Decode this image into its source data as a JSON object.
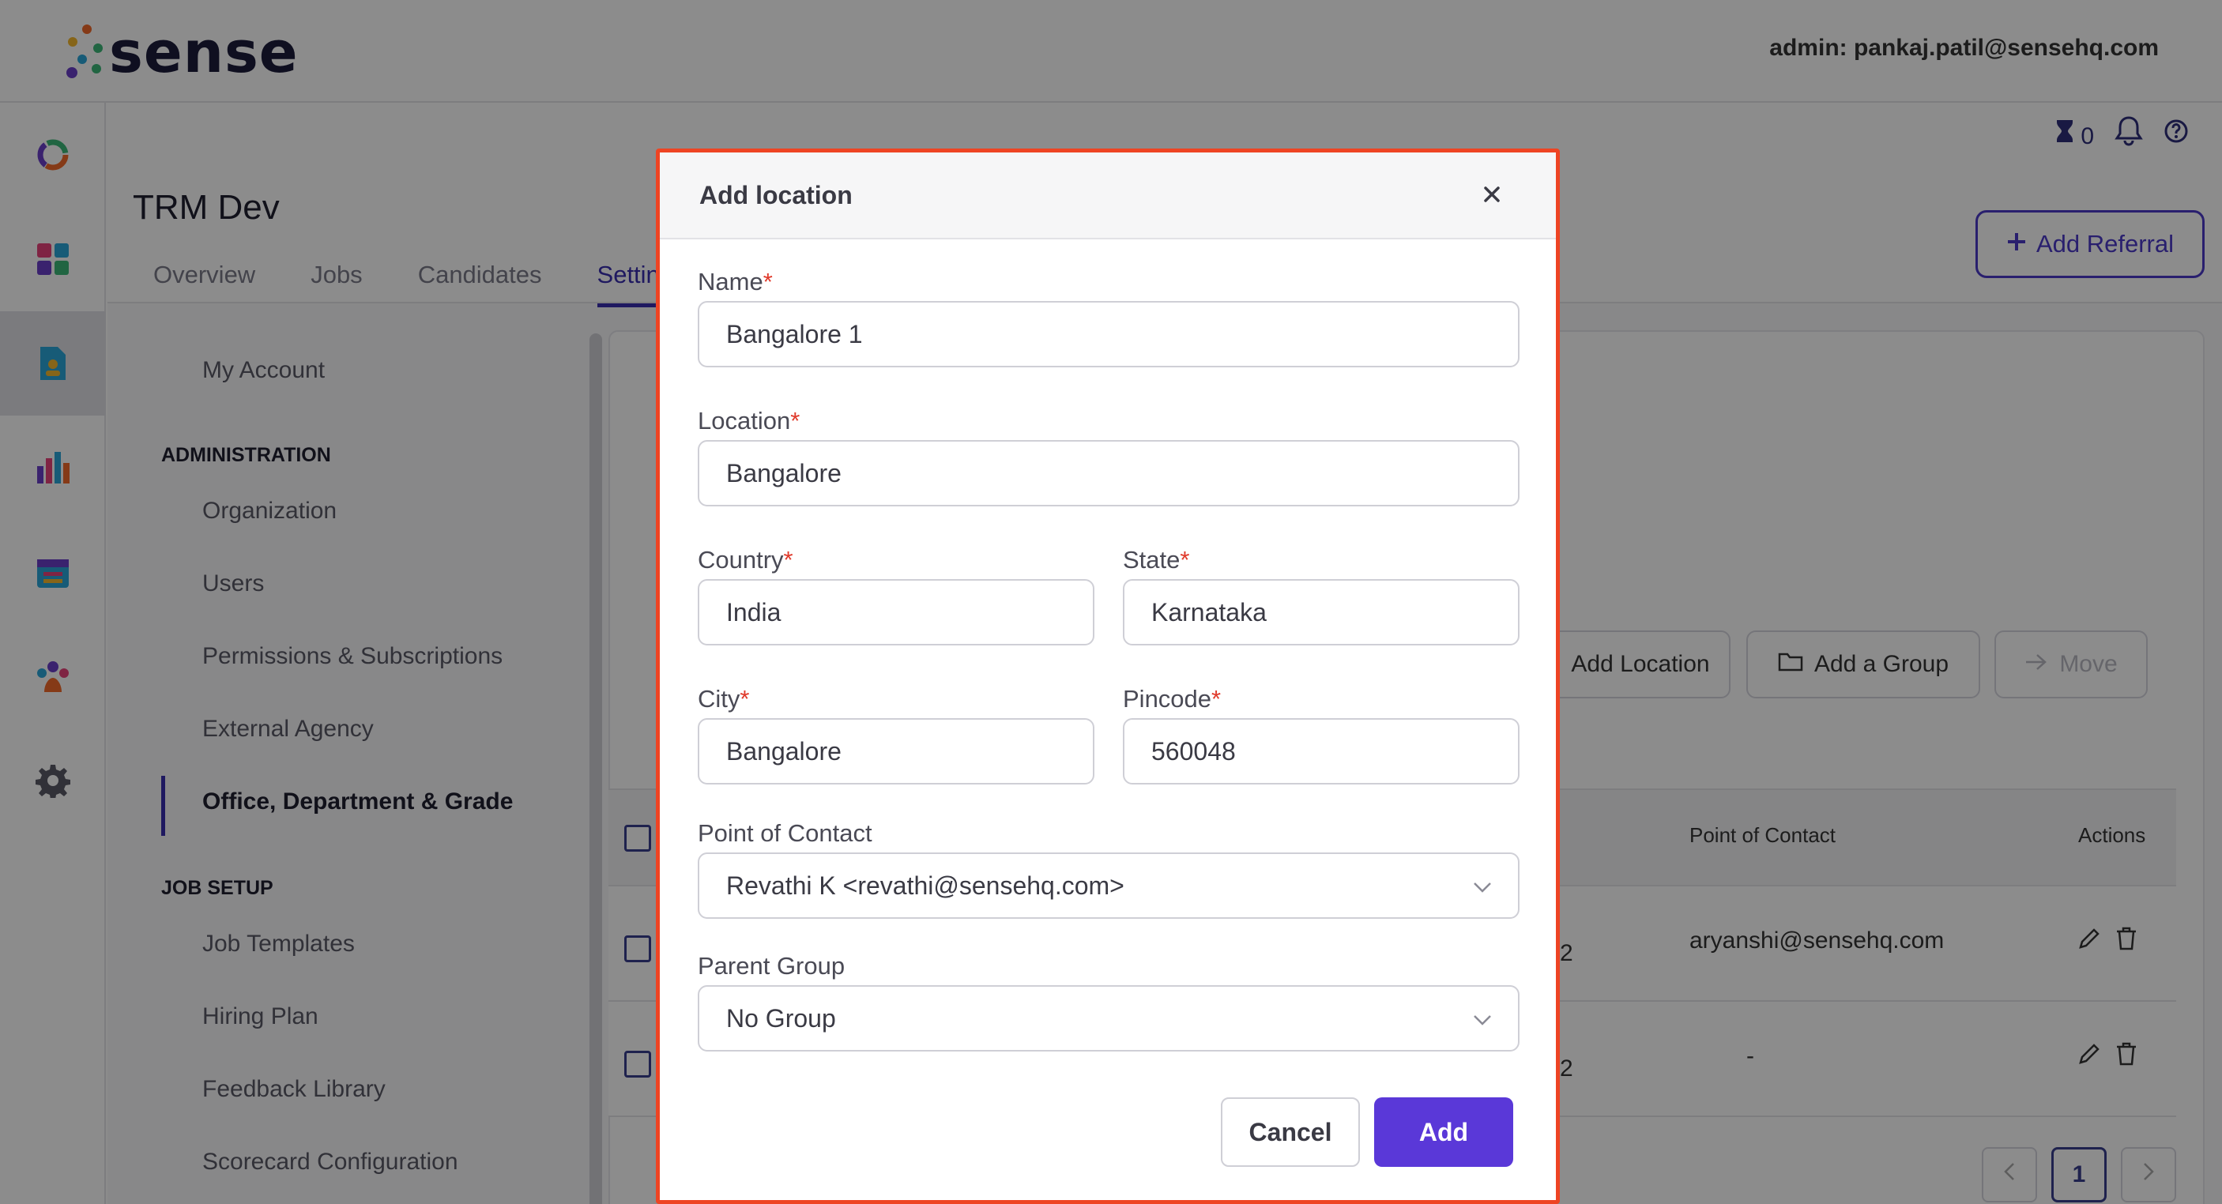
{
  "header": {
    "brand": "sense",
    "admin": "admin: pankaj.patil@sensehq.com"
  },
  "sidebar": {
    "icons": [
      "ring-chart-icon",
      "dashboard-icon",
      "document-user-icon",
      "bar-chart-icon",
      "calendar-icon",
      "people-icon",
      "gear-icon"
    ]
  },
  "topbar": {
    "timer_count": "0"
  },
  "page": {
    "title": "TRM Dev",
    "tabs": [
      "Overview",
      "Jobs",
      "Candidates",
      "Settings"
    ],
    "add_referral": "Add Referral"
  },
  "settings_nav": {
    "my_account": "My Account",
    "administration": "ADMINISTRATION",
    "admin_items": [
      "Organization",
      "Users",
      "Permissions & Subscriptions",
      "External Agency",
      "Office, Department & Grade"
    ],
    "job_setup": "JOB SETUP",
    "job_items": [
      "Job Templates",
      "Hiring Plan",
      "Feedback Library",
      "Scorecard Configuration"
    ]
  },
  "content": {
    "actions": {
      "add_location": "Add Location",
      "add_group": "Add a Group",
      "move": "Move"
    },
    "table": {
      "columns": {
        "point_of_contact": "Point of Contact",
        "actions": "Actions"
      },
      "rows": [
        {
          "count": "2",
          "contact": "aryanshi@sensehq.com"
        },
        {
          "count": "2",
          "contact": "-"
        }
      ]
    },
    "pagination": {
      "current": "1"
    }
  },
  "modal": {
    "title": "Add location",
    "fields": {
      "name": {
        "label": "Name",
        "value": "Bangalore 1"
      },
      "location": {
        "label": "Location",
        "value": "Bangalore"
      },
      "country": {
        "label": "Country",
        "value": "India"
      },
      "state": {
        "label": "State",
        "value": "Karnataka"
      },
      "city": {
        "label": "City",
        "value": "Bangalore"
      },
      "pincode": {
        "label": "Pincode",
        "value": "560048"
      },
      "point_of_contact": {
        "label": "Point of Contact",
        "value": "Revathi K <revathi@sensehq.com>"
      },
      "parent_group": {
        "label": "Parent Group",
        "value": "No Group"
      }
    },
    "required_mark": "*",
    "cancel": "Cancel",
    "add": "Add"
  },
  "colors": {
    "primary": "#5a38d8",
    "modal_border": "#ee4423",
    "required": "#e03a2b"
  }
}
